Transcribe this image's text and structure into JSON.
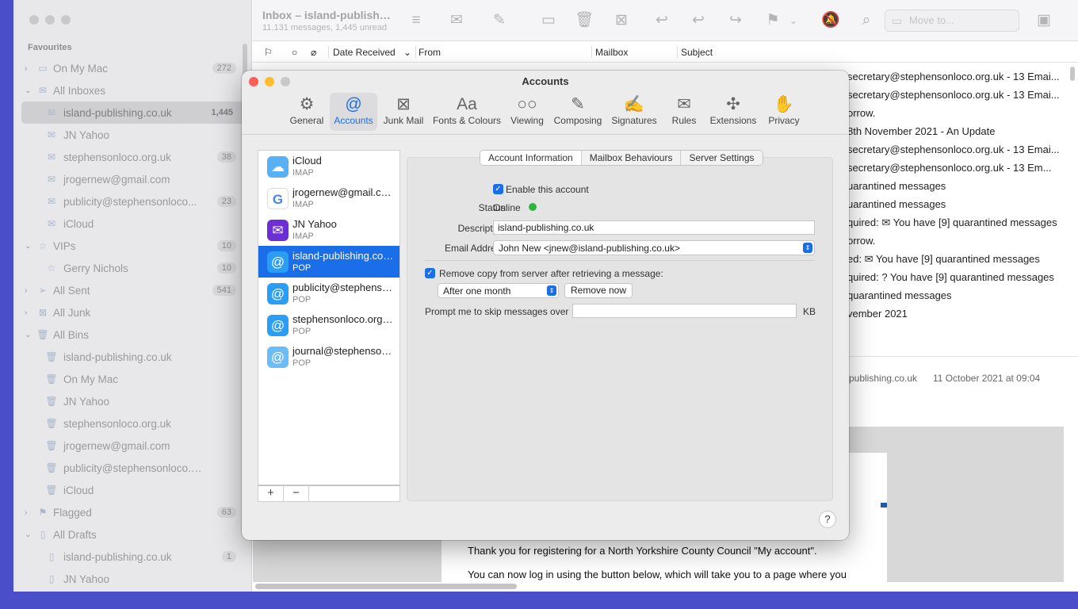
{
  "sidebar": {
    "section_title": "Favourites",
    "items": [
      {
        "label": "On My Mac",
        "badge": "272",
        "icon": "computer-icon",
        "glyph": "▭",
        "level": 0,
        "chevron": "›"
      },
      {
        "label": "All Inboxes",
        "badge": "",
        "icon": "inbox-icon",
        "glyph": "✉",
        "level": 0,
        "chevron": "⌄"
      },
      {
        "label": "island-publishing.co.uk",
        "badge": "1,445",
        "icon": "inbox-icon",
        "glyph": "✉",
        "level": 1,
        "selected": true
      },
      {
        "label": "JN Yahoo",
        "badge": "",
        "icon": "inbox-icon",
        "glyph": "✉",
        "level": 1
      },
      {
        "label": "stephensonloco.org.uk",
        "badge": "38",
        "icon": "inbox-icon",
        "glyph": "✉",
        "level": 1
      },
      {
        "label": "jrogernew@gmail.com",
        "badge": "",
        "icon": "inbox-icon",
        "glyph": "✉",
        "level": 1
      },
      {
        "label": "publicity@stephensonlocо...",
        "badge": "23",
        "icon": "inbox-icon",
        "glyph": "✉",
        "level": 1
      },
      {
        "label": "iCloud",
        "badge": "",
        "icon": "inbox-icon",
        "glyph": "✉",
        "level": 1
      },
      {
        "label": "VIPs",
        "badge": "10",
        "icon": "star-icon",
        "glyph": "☆",
        "level": 0,
        "chevron": "⌄"
      },
      {
        "label": "Gerry Nichols",
        "badge": "10",
        "icon": "star-icon",
        "glyph": "☆",
        "level": 1
      },
      {
        "label": "All Sent",
        "badge": "541",
        "icon": "send-icon",
        "glyph": "➢",
        "level": 0,
        "chevron": "›"
      },
      {
        "label": "All Junk",
        "badge": "",
        "icon": "junk-icon",
        "glyph": "⊠",
        "level": 0,
        "chevron": "›"
      },
      {
        "label": "All Bins",
        "badge": "",
        "icon": "trash-icon",
        "glyph": "🗑",
        "level": 0,
        "chevron": "⌄"
      },
      {
        "label": "island-publishing.co.uk",
        "badge": "",
        "icon": "trash-icon",
        "glyph": "🗑",
        "level": 1
      },
      {
        "label": "On My Mac",
        "badge": "",
        "icon": "trash-icon",
        "glyph": "🗑",
        "level": 1
      },
      {
        "label": "JN Yahoo",
        "badge": "",
        "icon": "trash-icon",
        "glyph": "🗑",
        "level": 1
      },
      {
        "label": "stephensonloco.org.uk",
        "badge": "",
        "icon": "trash-icon",
        "glyph": "🗑",
        "level": 1
      },
      {
        "label": "jrogernew@gmail.com",
        "badge": "",
        "icon": "trash-icon",
        "glyph": "🗑",
        "level": 1
      },
      {
        "label": "publicity@stephensonloco.org.uk",
        "badge": "",
        "icon": "trash-icon",
        "glyph": "🗑",
        "level": 1
      },
      {
        "label": "iCloud",
        "badge": "",
        "icon": "trash-icon",
        "glyph": "🗑",
        "level": 1
      },
      {
        "label": "Flagged",
        "badge": "63",
        "icon": "flag-icon",
        "glyph": "⚑",
        "level": 0,
        "chevron": "›"
      },
      {
        "label": "All Drafts",
        "badge": "",
        "icon": "draft-icon",
        "glyph": "▯",
        "level": 0,
        "chevron": "⌄"
      },
      {
        "label": "island-publishing.co.uk",
        "badge": "1",
        "icon": "draft-icon",
        "glyph": "▯",
        "level": 1
      },
      {
        "label": "JN Yahoo",
        "badge": "",
        "icon": "draft-icon",
        "glyph": "▯",
        "level": 1
      }
    ]
  },
  "toolbar": {
    "title": "Inbox – island-publishing.co.uk",
    "subtitle": "11,131 messages, 1,445 unread",
    "move_to_placeholder": "Move to...",
    "icons": [
      {
        "name": "filter-icon",
        "glyph": "≡"
      },
      {
        "name": "get-mail-icon",
        "glyph": "✉"
      },
      {
        "name": "compose-icon",
        "glyph": "✎"
      },
      {
        "name": "archive-icon",
        "glyph": "▭"
      },
      {
        "name": "delete-icon",
        "glyph": "🗑"
      },
      {
        "name": "junk-icon",
        "glyph": "⊠"
      },
      {
        "name": "reply-icon",
        "glyph": "↩"
      },
      {
        "name": "reply-all-icon",
        "glyph": "↩"
      },
      {
        "name": "forward-icon",
        "glyph": "↪"
      },
      {
        "name": "flag-icon",
        "glyph": "⚑"
      },
      {
        "name": "flag-menu-chevron-icon",
        "glyph": "⌄"
      },
      {
        "name": "mute-icon",
        "glyph": "🔕"
      },
      {
        "name": "search-icon",
        "glyph": "⌕"
      },
      {
        "name": "trash-toolbar-icon",
        "glyph": "▣"
      }
    ]
  },
  "columns": {
    "date": "Date Received",
    "from": "From",
    "mailbox": "Mailbox",
    "subject": "Subject"
  },
  "messages": [
    "secretary@stephensonloco.org.uk - 13 Emai...",
    "secretary@stephensonloco.org.uk - 13 Emai...",
    "orrow.",
    "8th November 2021 - An Update",
    "secretary@stephensonloco.org.uk - 13 Emai...",
    "secretary@stephensonloco.org.uk - 13 Em...",
    "uarantined messages",
    "uarantined messages",
    "quired: ✉ You have [9] quarantined messages",
    "orrow.",
    "ed: ✉ You have [9] quarantined messages",
    "quired: ? You have [9] quarantined messages",
    "quarantined messages",
    "vember 2021"
  ],
  "preview": {
    "to": "-publishing.co.uk",
    "date": "11 October 2021 at 09:04",
    "line1": "Thank you for registering for a North Yorkshire County Council \"My account\".",
    "line2": "You can now log in using the button below, which will take you to a page where you"
  },
  "dialog": {
    "title": "Accounts",
    "tabs": [
      {
        "label": "General",
        "icon": "gear-icon",
        "glyph": "⚙"
      },
      {
        "label": "Accounts",
        "icon": "at-icon",
        "glyph": "@",
        "active": true
      },
      {
        "label": "Junk Mail",
        "icon": "junk-mail-icon",
        "glyph": "⊠"
      },
      {
        "label": "Fonts & Colours",
        "icon": "fonts-icon",
        "glyph": "Aa"
      },
      {
        "label": "Viewing",
        "icon": "glasses-icon",
        "glyph": "○○"
      },
      {
        "label": "Composing",
        "icon": "compose-icon",
        "glyph": "✎"
      },
      {
        "label": "Signatures",
        "icon": "signature-icon",
        "glyph": "✍"
      },
      {
        "label": "Rules",
        "icon": "rules-icon",
        "glyph": "✉"
      },
      {
        "label": "Extensions",
        "icon": "puzzle-icon",
        "glyph": "✣"
      },
      {
        "label": "Privacy",
        "icon": "hand-icon",
        "glyph": "✋"
      }
    ],
    "accounts": [
      {
        "name": "iCloud",
        "type": "IMAP",
        "icon": "icloud-icon",
        "glyph": "☁",
        "color": "#5ab0f5"
      },
      {
        "name": "jrogernew@gmail.com",
        "type": "IMAP",
        "icon": "google-icon",
        "glyph": "G",
        "color": "#ffffff"
      },
      {
        "name": "JN Yahoo",
        "type": "IMAP",
        "icon": "yahoo-icon",
        "glyph": "✉",
        "color": "#6b2fd3"
      },
      {
        "name": "island-publishing.co.uk",
        "type": "POP",
        "icon": "at-icon",
        "glyph": "@",
        "color": "#2a9df4",
        "selected": true
      },
      {
        "name": "publicity@stephensonloco.org.uk",
        "type": "POP",
        "icon": "at-icon",
        "glyph": "@",
        "color": "#2a9df4"
      },
      {
        "name": "stephensonloco.org.uk",
        "type": "POP",
        "icon": "at-icon",
        "glyph": "@",
        "color": "#2a9df4"
      },
      {
        "name": "journal@stephensonloco.org.uk",
        "type": "POP",
        "icon": "at-icon",
        "glyph": "@",
        "color": "#6cbcf5"
      }
    ],
    "add_label": "+",
    "remove_label": "−",
    "segments": [
      "Account Information",
      "Mailbox Behaviours",
      "Server Settings"
    ],
    "enable_label": "Enable this account",
    "status_label": "Status:",
    "status_value": "Online",
    "status_color": "#2db53c",
    "description_label": "Description:",
    "description_value": "island-publishing.co.uk",
    "email_label": "Email Address:",
    "email_value": "John New <jnew@island-publishing.co.uk>",
    "remove_copy_label": "Remove copy from server after retrieving a message:",
    "remove_after_value": "After one month",
    "remove_now_label": "Remove now",
    "prompt_label": "Prompt me to skip messages over",
    "prompt_value": "",
    "kb_label": "KB",
    "help_label": "?"
  }
}
